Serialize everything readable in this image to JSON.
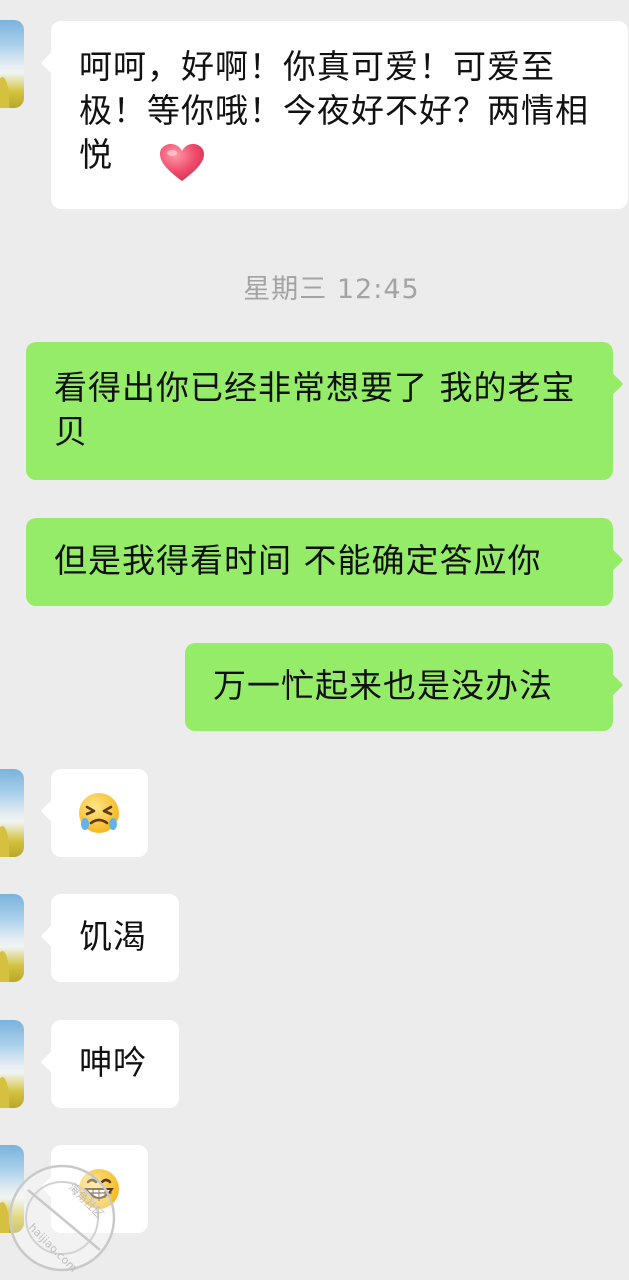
{
  "chat": {
    "time_separator": "星期三 12:45",
    "messages": [
      {
        "from": "contact",
        "text": "呵呵，好啊！你真可爱！可爱至极！等你哦！今夜好不好？两情相悦",
        "emoji": "heart-emoji"
      },
      {
        "from": "self",
        "text": "看得出你已经非常想要了 我的老宝贝"
      },
      {
        "from": "self",
        "text": "但是我得看时间 不能确定答应你"
      },
      {
        "from": "self",
        "text": "万一忙起来也是没办法"
      },
      {
        "from": "contact",
        "emoji": "crying-face-emoji"
      },
      {
        "from": "contact",
        "text": "饥渴"
      },
      {
        "from": "contact",
        "text": "呻吟"
      },
      {
        "from": "contact",
        "emoji": "grinning-face-emoji"
      }
    ]
  },
  "watermark": {
    "text_top": "海角社区",
    "text_bottom": "haijiao.com"
  },
  "colors": {
    "background": "#ececec",
    "incoming_bubble": "#ffffff",
    "outgoing_bubble": "#95ec69",
    "timestamp_text": "#a3a3a3",
    "heart": "#f0506e"
  }
}
